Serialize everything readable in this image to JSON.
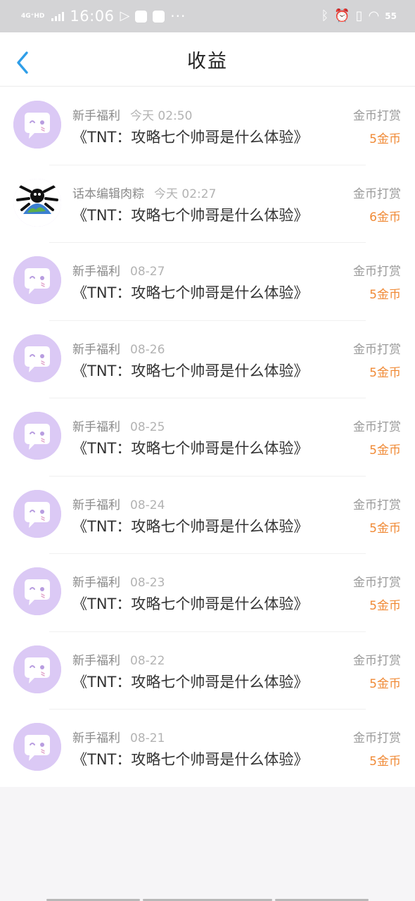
{
  "status_bar": {
    "network": "4G⁺HD",
    "time": "16:06",
    "battery": "55"
  },
  "header": {
    "title": "收益"
  },
  "records": [
    {
      "sender": "新手福利",
      "time": "今天 02:50",
      "book": "《TNT：攻略七个帅哥是什么体验》",
      "kind": "金币打赏",
      "amount": "5金币",
      "avatar": "default-avatar"
    },
    {
      "sender": "话本编辑肉粽",
      "time": "今天 02:27",
      "book": "《TNT：攻略七个帅哥是什么体验》",
      "kind": "金币打赏",
      "amount": "6金币",
      "avatar": "earth-avatar"
    },
    {
      "sender": "新手福利",
      "time": "08-27",
      "book": "《TNT：攻略七个帅哥是什么体验》",
      "kind": "金币打赏",
      "amount": "5金币",
      "avatar": "default-avatar"
    },
    {
      "sender": "新手福利",
      "time": "08-26",
      "book": "《TNT：攻略七个帅哥是什么体验》",
      "kind": "金币打赏",
      "amount": "5金币",
      "avatar": "default-avatar"
    },
    {
      "sender": "新手福利",
      "time": "08-25",
      "book": "《TNT：攻略七个帅哥是什么体验》",
      "kind": "金币打赏",
      "amount": "5金币",
      "avatar": "default-avatar"
    },
    {
      "sender": "新手福利",
      "time": "08-24",
      "book": "《TNT：攻略七个帅哥是什么体验》",
      "kind": "金币打赏",
      "amount": "5金币",
      "avatar": "default-avatar"
    },
    {
      "sender": "新手福利",
      "time": "08-23",
      "book": "《TNT：攻略七个帅哥是什么体验》",
      "kind": "金币打赏",
      "amount": "5金币",
      "avatar": "default-avatar"
    },
    {
      "sender": "新手福利",
      "time": "08-22",
      "book": "《TNT：攻略七个帅哥是什么体验》",
      "kind": "金币打赏",
      "amount": "5金币",
      "avatar": "default-avatar"
    },
    {
      "sender": "新手福利",
      "time": "08-21",
      "book": "《TNT：攻略七个帅哥是什么体验》",
      "kind": "金币打赏",
      "amount": "5金币",
      "avatar": "default-avatar"
    }
  ],
  "colors": {
    "accent_blue": "#2f9ee8",
    "amount_orange": "#f08a36",
    "avatar_purple": "#dbc9f5"
  }
}
